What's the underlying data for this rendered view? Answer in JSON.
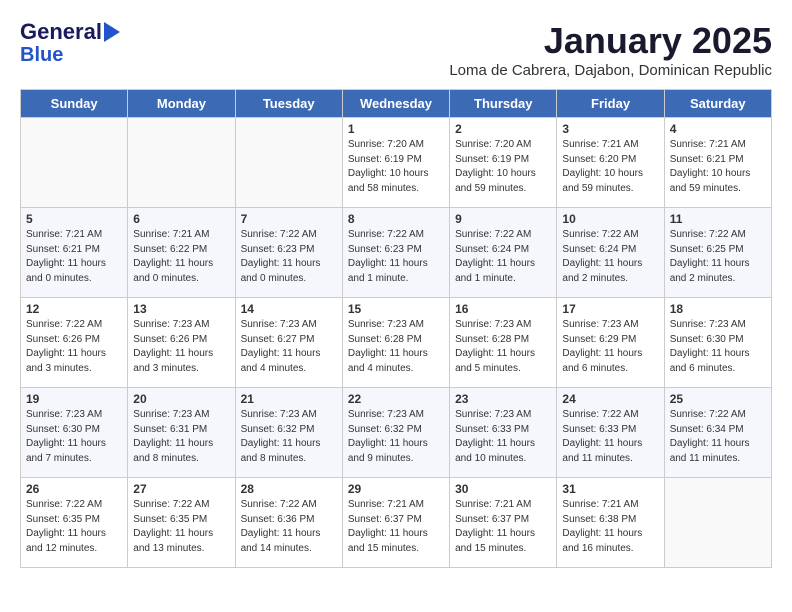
{
  "header": {
    "logo_line1": "General",
    "logo_line2": "Blue",
    "month_title": "January 2025",
    "subtitle": "Loma de Cabrera, Dajabon, Dominican Republic"
  },
  "days_of_week": [
    "Sunday",
    "Monday",
    "Tuesday",
    "Wednesday",
    "Thursday",
    "Friday",
    "Saturday"
  ],
  "weeks": [
    [
      {
        "day": "",
        "info": ""
      },
      {
        "day": "",
        "info": ""
      },
      {
        "day": "",
        "info": ""
      },
      {
        "day": "1",
        "info": "Sunrise: 7:20 AM\nSunset: 6:19 PM\nDaylight: 10 hours\nand 58 minutes."
      },
      {
        "day": "2",
        "info": "Sunrise: 7:20 AM\nSunset: 6:19 PM\nDaylight: 10 hours\nand 59 minutes."
      },
      {
        "day": "3",
        "info": "Sunrise: 7:21 AM\nSunset: 6:20 PM\nDaylight: 10 hours\nand 59 minutes."
      },
      {
        "day": "4",
        "info": "Sunrise: 7:21 AM\nSunset: 6:21 PM\nDaylight: 10 hours\nand 59 minutes."
      }
    ],
    [
      {
        "day": "5",
        "info": "Sunrise: 7:21 AM\nSunset: 6:21 PM\nDaylight: 11 hours\nand 0 minutes."
      },
      {
        "day": "6",
        "info": "Sunrise: 7:21 AM\nSunset: 6:22 PM\nDaylight: 11 hours\nand 0 minutes."
      },
      {
        "day": "7",
        "info": "Sunrise: 7:22 AM\nSunset: 6:23 PM\nDaylight: 11 hours\nand 0 minutes."
      },
      {
        "day": "8",
        "info": "Sunrise: 7:22 AM\nSunset: 6:23 PM\nDaylight: 11 hours\nand 1 minute."
      },
      {
        "day": "9",
        "info": "Sunrise: 7:22 AM\nSunset: 6:24 PM\nDaylight: 11 hours\nand 1 minute."
      },
      {
        "day": "10",
        "info": "Sunrise: 7:22 AM\nSunset: 6:24 PM\nDaylight: 11 hours\nand 2 minutes."
      },
      {
        "day": "11",
        "info": "Sunrise: 7:22 AM\nSunset: 6:25 PM\nDaylight: 11 hours\nand 2 minutes."
      }
    ],
    [
      {
        "day": "12",
        "info": "Sunrise: 7:22 AM\nSunset: 6:26 PM\nDaylight: 11 hours\nand 3 minutes."
      },
      {
        "day": "13",
        "info": "Sunrise: 7:23 AM\nSunset: 6:26 PM\nDaylight: 11 hours\nand 3 minutes."
      },
      {
        "day": "14",
        "info": "Sunrise: 7:23 AM\nSunset: 6:27 PM\nDaylight: 11 hours\nand 4 minutes."
      },
      {
        "day": "15",
        "info": "Sunrise: 7:23 AM\nSunset: 6:28 PM\nDaylight: 11 hours\nand 4 minutes."
      },
      {
        "day": "16",
        "info": "Sunrise: 7:23 AM\nSunset: 6:28 PM\nDaylight: 11 hours\nand 5 minutes."
      },
      {
        "day": "17",
        "info": "Sunrise: 7:23 AM\nSunset: 6:29 PM\nDaylight: 11 hours\nand 6 minutes."
      },
      {
        "day": "18",
        "info": "Sunrise: 7:23 AM\nSunset: 6:30 PM\nDaylight: 11 hours\nand 6 minutes."
      }
    ],
    [
      {
        "day": "19",
        "info": "Sunrise: 7:23 AM\nSunset: 6:30 PM\nDaylight: 11 hours\nand 7 minutes."
      },
      {
        "day": "20",
        "info": "Sunrise: 7:23 AM\nSunset: 6:31 PM\nDaylight: 11 hours\nand 8 minutes."
      },
      {
        "day": "21",
        "info": "Sunrise: 7:23 AM\nSunset: 6:32 PM\nDaylight: 11 hours\nand 8 minutes."
      },
      {
        "day": "22",
        "info": "Sunrise: 7:23 AM\nSunset: 6:32 PM\nDaylight: 11 hours\nand 9 minutes."
      },
      {
        "day": "23",
        "info": "Sunrise: 7:23 AM\nSunset: 6:33 PM\nDaylight: 11 hours\nand 10 minutes."
      },
      {
        "day": "24",
        "info": "Sunrise: 7:22 AM\nSunset: 6:33 PM\nDaylight: 11 hours\nand 11 minutes."
      },
      {
        "day": "25",
        "info": "Sunrise: 7:22 AM\nSunset: 6:34 PM\nDaylight: 11 hours\nand 11 minutes."
      }
    ],
    [
      {
        "day": "26",
        "info": "Sunrise: 7:22 AM\nSunset: 6:35 PM\nDaylight: 11 hours\nand 12 minutes."
      },
      {
        "day": "27",
        "info": "Sunrise: 7:22 AM\nSunset: 6:35 PM\nDaylight: 11 hours\nand 13 minutes."
      },
      {
        "day": "28",
        "info": "Sunrise: 7:22 AM\nSunset: 6:36 PM\nDaylight: 11 hours\nand 14 minutes."
      },
      {
        "day": "29",
        "info": "Sunrise: 7:21 AM\nSunset: 6:37 PM\nDaylight: 11 hours\nand 15 minutes."
      },
      {
        "day": "30",
        "info": "Sunrise: 7:21 AM\nSunset: 6:37 PM\nDaylight: 11 hours\nand 15 minutes."
      },
      {
        "day": "31",
        "info": "Sunrise: 7:21 AM\nSunset: 6:38 PM\nDaylight: 11 hours\nand 16 minutes."
      },
      {
        "day": "",
        "info": ""
      }
    ]
  ]
}
